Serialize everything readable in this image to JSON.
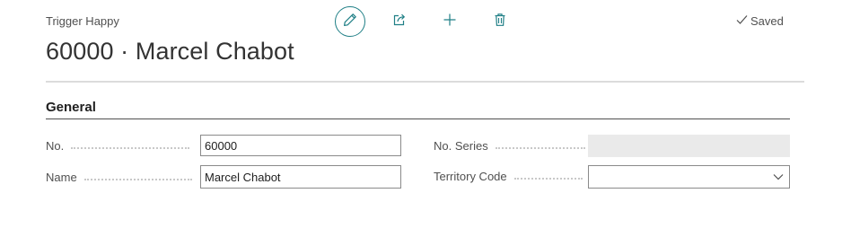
{
  "header": {
    "caption": "Trigger Happy",
    "title": "60000 · Marcel Chabot",
    "status": "Saved"
  },
  "toolbar": {
    "icons": [
      "edit-icon",
      "share-icon",
      "add-icon",
      "delete-icon"
    ],
    "accent_color": "#1f7f86"
  },
  "section": {
    "title": "General"
  },
  "fields": {
    "no": {
      "label": "No.",
      "value": "60000"
    },
    "name": {
      "label": "Name",
      "value": "Marcel Chabot"
    },
    "no_series": {
      "label": "No. Series",
      "value": ""
    },
    "territory_code": {
      "label": "Territory Code",
      "value": ""
    }
  }
}
